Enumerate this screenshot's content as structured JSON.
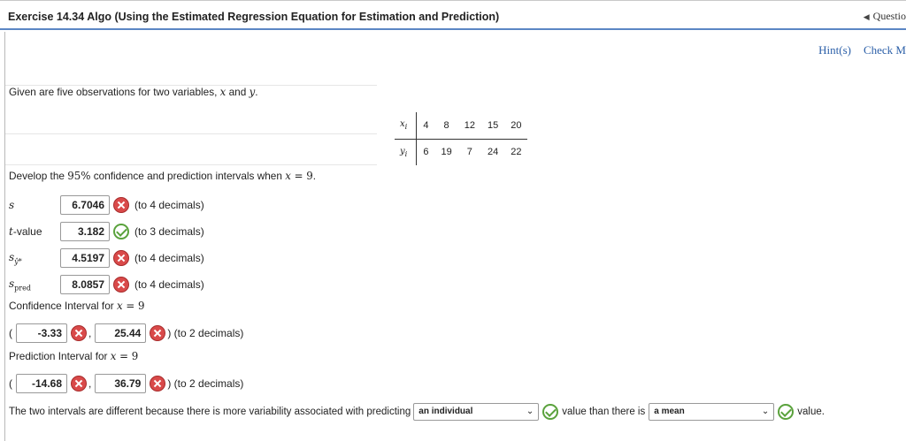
{
  "header": {
    "title": "Exercise 14.34 Algo (Using the Estimated Regression Equation for Estimation and Prediction)",
    "nav_label": "Questio"
  },
  "links": {
    "hints": "Hint(s)",
    "check": "Check M"
  },
  "intro": {
    "prefix": "Given are five observations for two variables, ",
    "var_x": "x",
    "and": " and ",
    "var_y": "y",
    "end": "."
  },
  "table": {
    "x_label": "xi",
    "y_label": "yi",
    "x_values": [
      "4",
      "8",
      "12",
      "15",
      "20"
    ],
    "y_values": [
      "6",
      "19",
      "7",
      "24",
      "22"
    ]
  },
  "task": {
    "prefix": "Develop the ",
    "pct": "95%",
    "middle": " confidence and prediction intervals when ",
    "var": "x",
    "eq": " = 9",
    "end": "."
  },
  "fields": [
    {
      "label": "s",
      "value": "6.7046",
      "status": "wrong",
      "note": "(to 4 decimals)"
    },
    {
      "label": "t-value",
      "value": "3.182",
      "status": "right",
      "note": "(to 3 decimals)"
    },
    {
      "label": "sŷ*",
      "value": "4.5197",
      "status": "wrong",
      "note": "(to 4 decimals)"
    },
    {
      "label": "spred",
      "value": "8.0857",
      "status": "wrong",
      "note": "(to 4 decimals)"
    }
  ],
  "confidence": {
    "heading": "Confidence Interval for ",
    "var": "x",
    "eq": " = 9",
    "lower": "-3.33",
    "upper": "25.44",
    "note": ") (to 2 decimals)"
  },
  "prediction": {
    "heading": "Prediction Interval for ",
    "var": "x",
    "eq": " = 9",
    "lower": "-14.68",
    "upper": "36.79",
    "note": ") (to 2 decimals)"
  },
  "conclusion": {
    "part1": "The two intervals are different because there is more variability associated with predicting",
    "select1": "an individual",
    "part2": "value than there is",
    "select2": "a mean",
    "part3": "value."
  },
  "colors": {
    "accent_border": "#5b86c4",
    "link": "#2b5fa8",
    "wrong": "#d94a4a",
    "right": "#5aa23c"
  }
}
